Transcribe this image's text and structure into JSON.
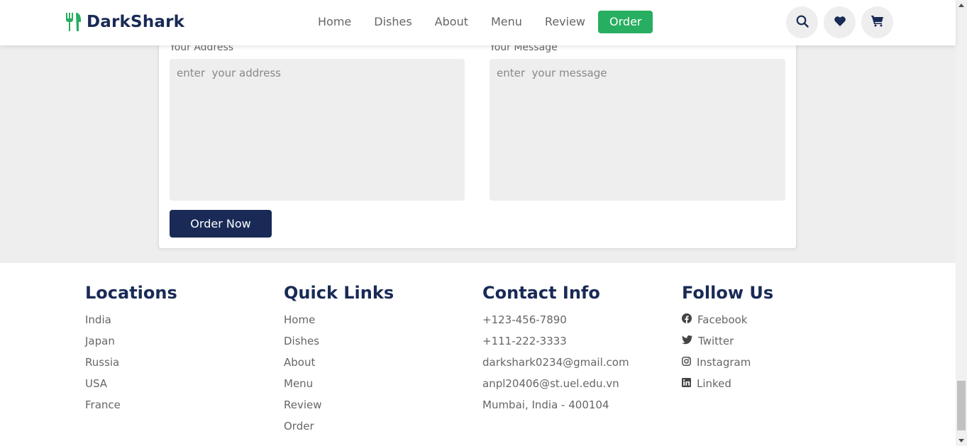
{
  "header": {
    "brand": "DarkShark",
    "nav": [
      "Home",
      "Dishes",
      "About",
      "Menu",
      "Review"
    ],
    "nav_active": "Order",
    "icons": [
      "search-icon",
      "heart-icon",
      "cart-icon"
    ]
  },
  "form": {
    "address_label": "Your Address",
    "address_placeholder": "enter  your address",
    "message_label": "Your Message",
    "message_placeholder": "enter  your message",
    "submit_label": "Order Now"
  },
  "footer": {
    "locations": {
      "title": "Locations",
      "items": [
        "India",
        "Japan",
        "Russia",
        "USA",
        "France"
      ]
    },
    "quick_links": {
      "title": "Quick Links",
      "items": [
        "Home",
        "Dishes",
        "About",
        "Menu",
        "Review",
        "Order"
      ]
    },
    "contact": {
      "title": "Contact Info",
      "items": [
        "+123-456-7890",
        "+111-222-3333",
        "darkshark0234@gmail.com",
        "anpl20406@st.uel.edu.vn",
        "Mumbai, India - 400104"
      ]
    },
    "follow": {
      "title": "Follow Us",
      "items": [
        "Facebook",
        "Twitter",
        "Instagram",
        "Linked"
      ]
    }
  },
  "colors": {
    "brand": "#192a56",
    "accent": "#27ae60",
    "muted": "#666666"
  }
}
